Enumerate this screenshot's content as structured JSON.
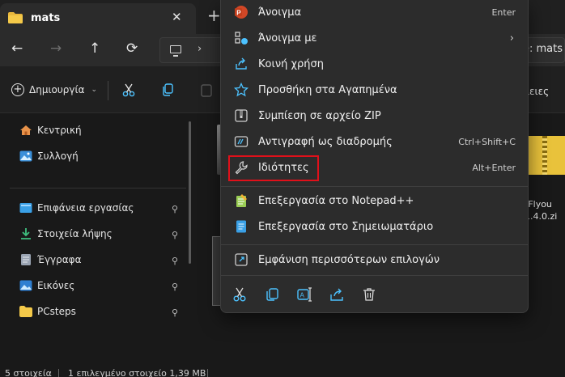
{
  "window": {
    "tab_title": "mats",
    "tab_close": "✕",
    "new_tab": "+"
  },
  "nav": {
    "back": "←",
    "forward": "→",
    "up": "↑",
    "refresh": "⟳",
    "address_separator": "›",
    "address_tail": "e: mats"
  },
  "command_bar": {
    "create_label": "Δημιουργία",
    "right_fragment": "ιειες"
  },
  "sidebar": {
    "items": [
      {
        "label": "Κεντρική",
        "icon": "home-icon"
      },
      {
        "label": "Συλλογή",
        "icon": "gallery-icon"
      },
      {
        "label": "Επιφάνεια εργασίας",
        "icon": "desktop-icon",
        "pinned": true
      },
      {
        "label": "Στοιχεία λήψης",
        "icon": "download-icon",
        "pinned": true
      },
      {
        "label": "Έγγραφα",
        "icon": "documents-icon",
        "pinned": true
      },
      {
        "label": "Εικόνες",
        "icon": "pictures-icon",
        "pinned": true
      },
      {
        "label": "PCsteps",
        "icon": "folder-icon",
        "pinned": true
      }
    ],
    "pin_glyph": "📌"
  },
  "content": {
    "zip_label_line1": "tFlyou",
    "zip_label_line2": "1.4.0.zi"
  },
  "status_bar": {
    "item_count": "5 στοιχεία",
    "selection": "1 επιλεγμένο στοιχείο 1,39 MB"
  },
  "context_menu": {
    "items": [
      {
        "label": "Άνοιγμα",
        "shortcut": "Enter",
        "icon": "powerpoint-icon"
      },
      {
        "label": "Άνοιγμα με",
        "submenu": "›",
        "icon": "open-with-icon"
      },
      {
        "label": "Κοινή χρήση",
        "icon": "share-icon"
      },
      {
        "label": "Προσθήκη στα Αγαπημένα",
        "icon": "star-icon"
      },
      {
        "label": "Συμπίεση σε αρχείο ZIP",
        "icon": "zip-icon"
      },
      {
        "label": "Αντιγραφή ως διαδρομής",
        "shortcut": "Ctrl+Shift+C",
        "icon": "copy-path-icon"
      },
      {
        "label": "Ιδιότητες",
        "shortcut": "Alt+Enter",
        "icon": "wrench-icon",
        "highlighted": true
      },
      {
        "label": "Επεξεργασία στο Notepad++",
        "icon": "notepadpp-icon"
      },
      {
        "label": "Επεξεργασία στο Σημειωματάριο",
        "icon": "notepad-icon"
      },
      {
        "label": "Εμφάνιση περισσότερων επιλογών",
        "icon": "more-options-icon"
      }
    ],
    "quick_actions": [
      "cut-icon",
      "copy-icon",
      "rename-icon",
      "share-icon",
      "delete-icon"
    ]
  },
  "colors": {
    "accent": "#4cc2ff",
    "highlight_box": "#e0101a",
    "menu_bg": "#2c2c2c",
    "window_bg": "#191919"
  }
}
